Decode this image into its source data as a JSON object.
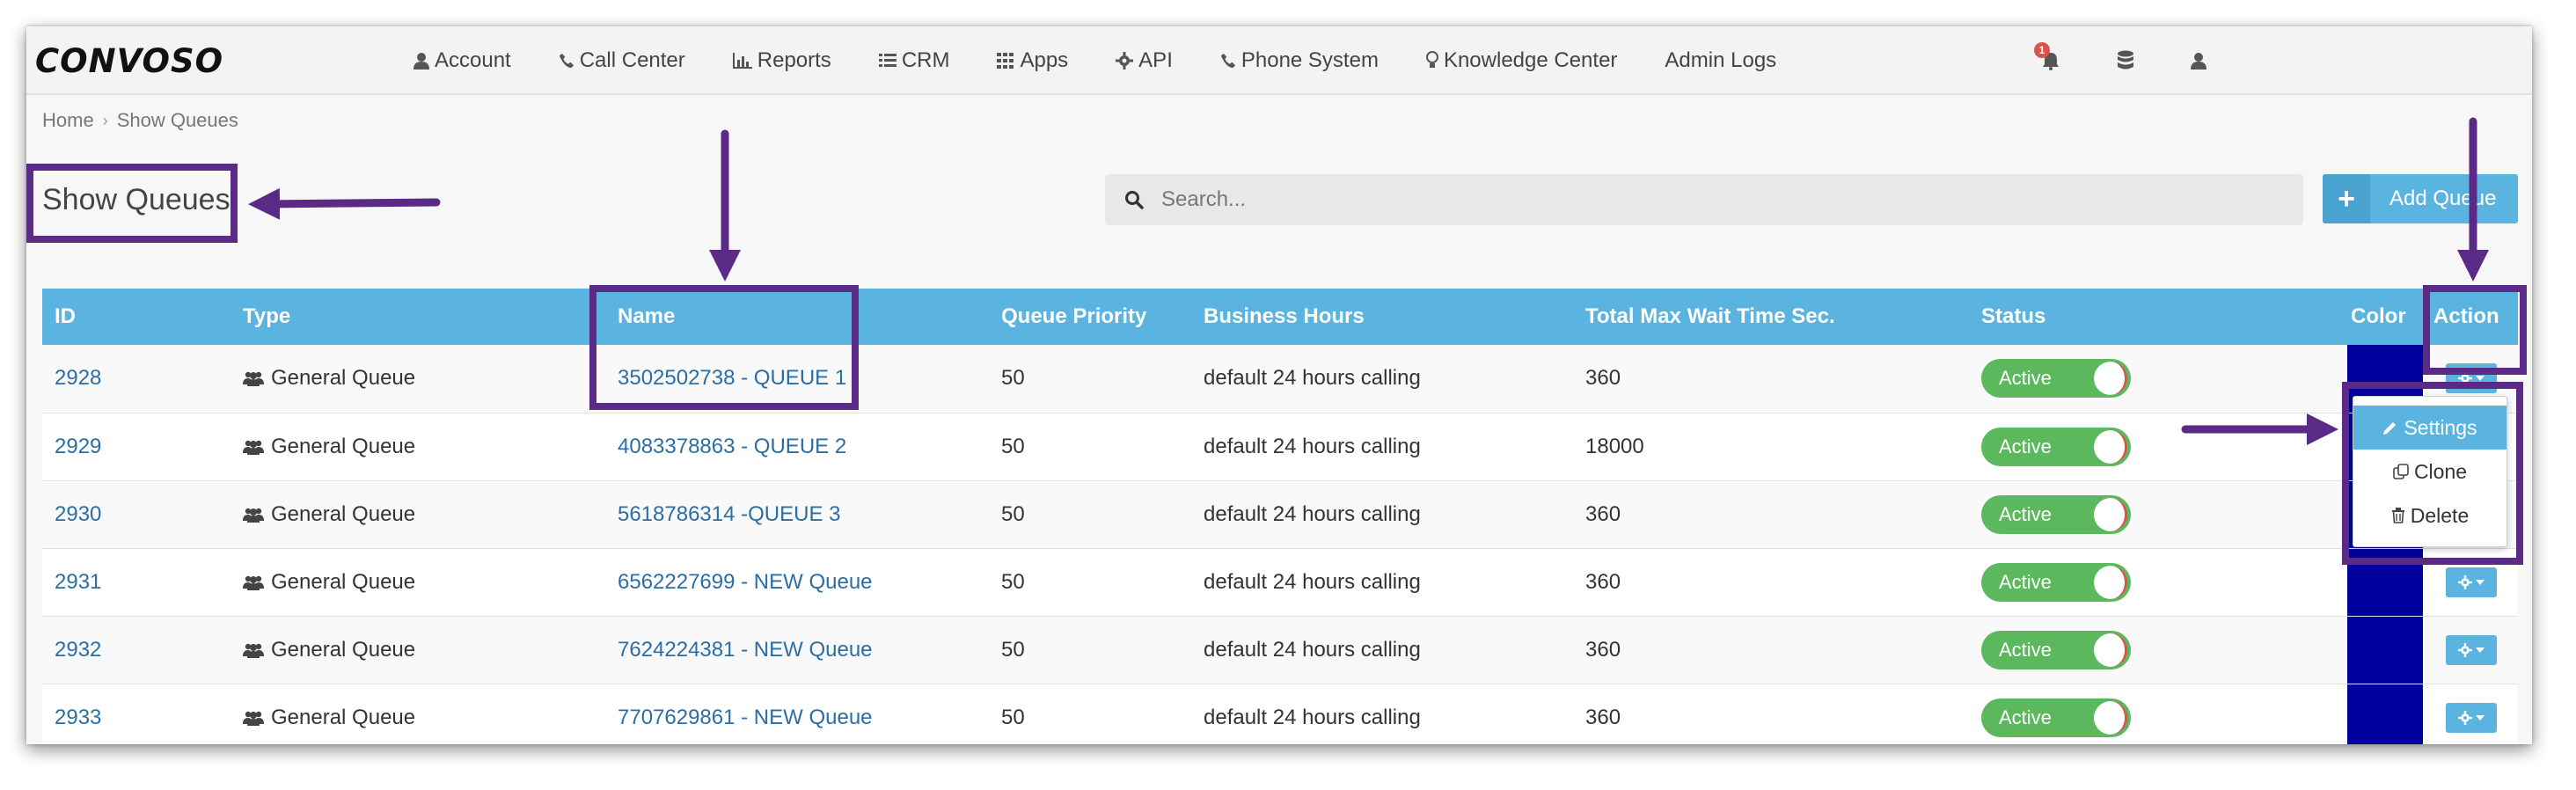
{
  "brand": {
    "logo_text": "CONVOSO"
  },
  "nav": {
    "items": [
      {
        "label": "Account",
        "icon": "user-icon"
      },
      {
        "label": "Call Center",
        "icon": "phone-icon"
      },
      {
        "label": "Reports",
        "icon": "bar-chart-icon"
      },
      {
        "label": "CRM",
        "icon": "list-icon"
      },
      {
        "label": "Apps",
        "icon": "grid-icon"
      },
      {
        "label": "API",
        "icon": "gear-icon"
      },
      {
        "label": "Phone System",
        "icon": "phone-icon"
      },
      {
        "label": "Knowledge Center",
        "icon": "lightbulb-icon"
      },
      {
        "label": "Admin Logs",
        "icon": ""
      }
    ],
    "notification_count": "1"
  },
  "breadcrumb": {
    "home": "Home",
    "current": "Show Queues"
  },
  "page": {
    "title": "Show Queues"
  },
  "search": {
    "placeholder": "Search..."
  },
  "toolbar": {
    "add_label": "Add Queue"
  },
  "table": {
    "headers": {
      "id": "ID",
      "type": "Type",
      "name": "Name",
      "priority": "Queue Priority",
      "hours": "Business Hours",
      "wait": "Total Max Wait Time Sec.",
      "status": "Status",
      "color": "Color",
      "action": "Action"
    },
    "rows": [
      {
        "id": "2928",
        "type": "General Queue",
        "name": "3502502738 - QUEUE 1",
        "priority": "50",
        "hours": "default 24 hours calling",
        "wait": "360",
        "status": "Active"
      },
      {
        "id": "2929",
        "type": "General Queue",
        "name": "4083378863 - QUEUE 2",
        "priority": "50",
        "hours": "default 24 hours calling",
        "wait": "18000",
        "status": "Active"
      },
      {
        "id": "2930",
        "type": "General Queue",
        "name": "5618786314 -QUEUE 3",
        "priority": "50",
        "hours": "default 24 hours calling",
        "wait": "360",
        "status": "Active"
      },
      {
        "id": "2931",
        "type": "General Queue",
        "name": "6562227699 - NEW Queue",
        "priority": "50",
        "hours": "default 24 hours calling",
        "wait": "360",
        "status": "Active"
      },
      {
        "id": "2932",
        "type": "General Queue",
        "name": "7624224381 - NEW Queue",
        "priority": "50",
        "hours": "default 24 hours calling",
        "wait": "360",
        "status": "Active"
      },
      {
        "id": "2933",
        "type": "General Queue",
        "name": "7707629861 - NEW Queue",
        "priority": "50",
        "hours": "default 24 hours calling",
        "wait": "360",
        "status": "Active"
      }
    ],
    "row_color": "#00009c"
  },
  "action_menu": {
    "settings": "Settings",
    "clone": "Clone",
    "delete": "Delete"
  },
  "colors": {
    "accent": "#5ab4df",
    "toggle_on": "#5cb85c",
    "annotation": "#5b2a86",
    "link": "#2c6ea3"
  }
}
